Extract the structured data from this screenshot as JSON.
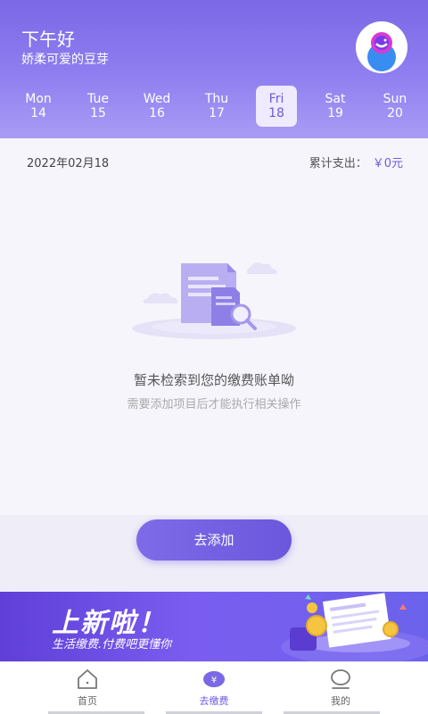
{
  "header": {
    "greeting": "下午好",
    "nickname": "娇柔可爱的豆芽"
  },
  "week": [
    {
      "day": "Mon",
      "num": "14",
      "selected": false
    },
    {
      "day": "Tue",
      "num": "15",
      "selected": false
    },
    {
      "day": "Wed",
      "num": "16",
      "selected": false
    },
    {
      "day": "Thu",
      "num": "17",
      "selected": false
    },
    {
      "day": "Fri",
      "num": "18",
      "selected": true
    },
    {
      "day": "Sat",
      "num": "19",
      "selected": false
    },
    {
      "day": "Sun",
      "num": "20",
      "selected": false
    }
  ],
  "summary": {
    "date": "2022年02月18",
    "total_label": "累计支出：",
    "total_value": "￥0元"
  },
  "empty": {
    "title": "暂未检索到您的缴费账单呦",
    "subtitle": "需要添加项目后才能执行相关操作"
  },
  "actions": {
    "add_label": "去添加"
  },
  "banner": {
    "title": "上新啦！",
    "subtitle": "生活缴费.付费吧更懂你"
  },
  "tabs": [
    {
      "label": "首页",
      "icon": "home-icon",
      "active": false
    },
    {
      "label": "去缴费",
      "icon": "payment-icon",
      "active": true
    },
    {
      "label": "我的",
      "icon": "profile-icon",
      "active": false
    }
  ],
  "colors": {
    "accent": "#6d5ddd",
    "header": "#8f7ff0"
  }
}
